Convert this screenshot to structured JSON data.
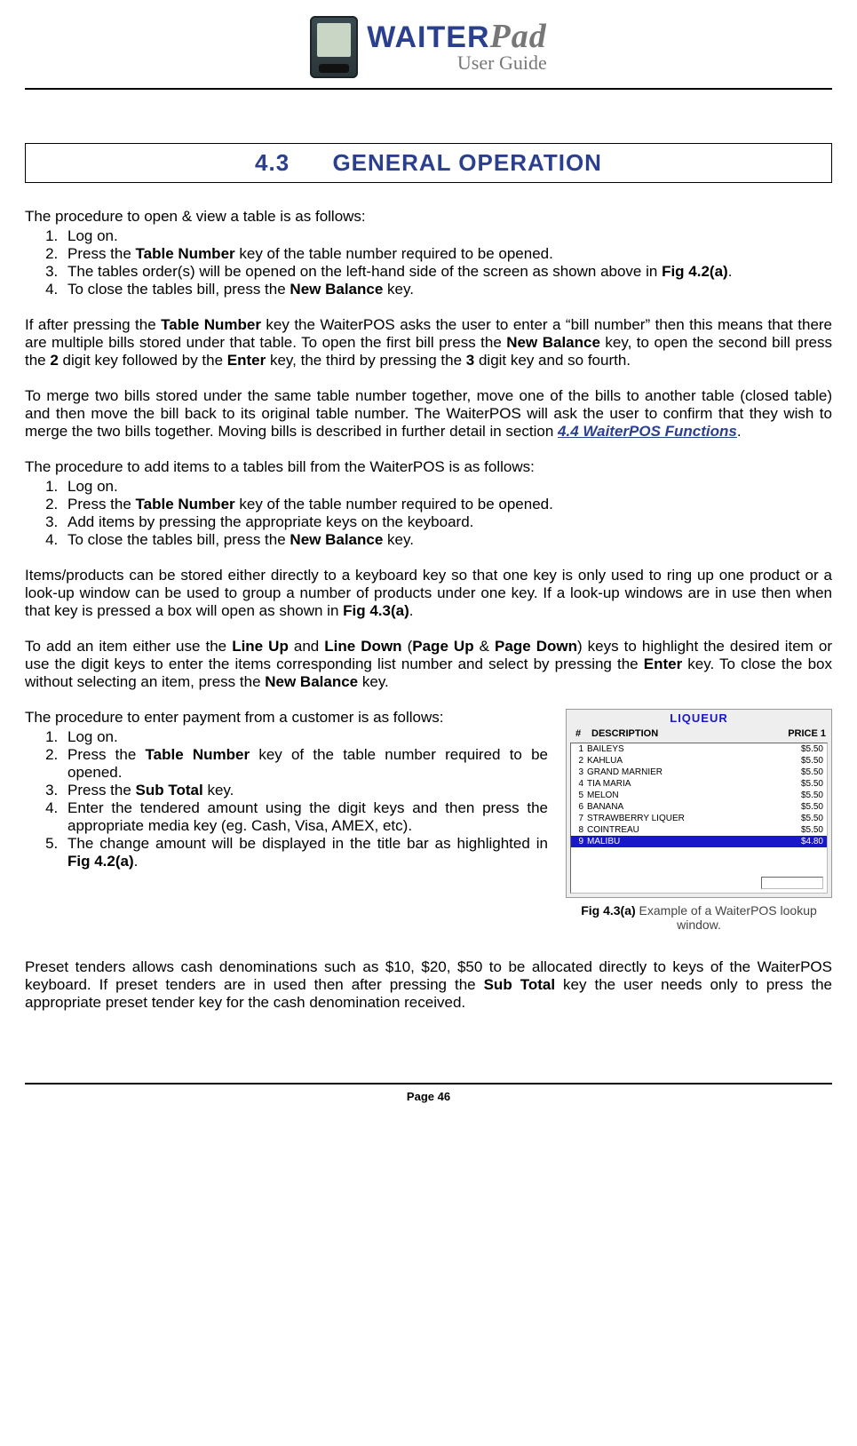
{
  "brand": {
    "name_main": "WAITER",
    "name_suffix": "Pad",
    "subtitle": "User Guide"
  },
  "section": {
    "number": "4.3",
    "title": "GENERAL OPERATION"
  },
  "proc_open_intro": "The procedure to open & view a table is as follows:",
  "proc_open": {
    "i1": "Log on.",
    "i2_a": "Press the ",
    "i2_b": "Table Number",
    "i2_c": " key of the table number required to be opened.",
    "i3_a": "The tables order(s) will be opened on the left-hand side of the screen as shown above in ",
    "i3_b": "Fig 4.2(a)",
    "i3_c": ".",
    "i4_a": "To close the tables bill, press the ",
    "i4_b": "New Balance",
    "i4_c": " key."
  },
  "bill_para": {
    "a": "If after pressing the ",
    "b": "Table Number",
    "c": " key the WaiterPOS asks the user to enter a “bill number” then this means that there are multiple bills stored under that table. To open the first bill press the ",
    "d": "New Balance",
    "e": " key, to open the second bill press the ",
    "f": "2",
    "g": " digit key followed by the ",
    "h": "Enter",
    "i": " key, the third by pressing the ",
    "j": "3",
    "k": " digit key and so fourth."
  },
  "merge_para": {
    "a": "To merge two bills stored under the same table number together, move one of the bills to another table (closed table) and then move the bill back to its original table number. The WaiterPOS will ask the user to confirm that they wish to merge the two bills together. Moving bills is described in further detail in section ",
    "link": "4.4 WaiterPOS Functions",
    "b": "."
  },
  "proc_add_intro": "The procedure to add items to a tables bill from the WaiterPOS is as follows:",
  "proc_add": {
    "i1": "Log on.",
    "i2_a": "Press the ",
    "i2_b": "Table Number",
    "i2_c": " key of the table number required to be opened.",
    "i3": "Add items by pressing the appropriate keys on the keyboard.",
    "i4_a": "To close the tables bill, press the ",
    "i4_b": "New Balance",
    "i4_c": " key."
  },
  "items_para": {
    "a": "Items/products can be stored either directly to a keyboard key so that one key is only used to ring up one product or a look-up window can be used to group a number of products under one key. If a look-up windows are in use then when that key is pressed a box will open as shown in ",
    "b": "Fig 4.3(a)",
    "c": "."
  },
  "lineup_para": {
    "a": "To add an item either use the ",
    "b": "Line Up",
    "c": " and ",
    "d": "Line Down",
    "e": " (",
    "f": "Page Up",
    "g": " & ",
    "h": "Page Down",
    "i": ") keys to highlight the desired item or use the digit keys to enter the items corresponding list number and select by pressing the ",
    "j": "Enter",
    "k": " key. To close the box without selecting an item, press the ",
    "l": "New Balance",
    "m": " key."
  },
  "proc_pay_intro": "The procedure to enter payment from a customer is as follows:",
  "proc_pay": {
    "i1": "Log on.",
    "i2_a": "Press the ",
    "i2_b": "Table Number",
    "i2_c": " key of the table number required to be opened.",
    "i3_a": "Press the ",
    "i3_b": "Sub Total",
    "i3_c": " key.",
    "i4": "Enter the tendered amount using the digit keys and then press the appropriate media key (eg. Cash, Visa, AMEX, etc).",
    "i5_a": "The change amount will be displayed in the title bar as highlighted in ",
    "i5_b": "Fig 4.2(a)",
    "i5_c": "."
  },
  "lookup": {
    "title": "LIQUEUR",
    "col_num": "#",
    "col_desc": "DESCRIPTION",
    "col_price": "PRICE 1",
    "rows": [
      {
        "n": "1",
        "d": "BAILEYS",
        "p": "$5.50"
      },
      {
        "n": "2",
        "d": "KAHLUA",
        "p": "$5.50"
      },
      {
        "n": "3",
        "d": "GRAND MARNIER",
        "p": "$5.50"
      },
      {
        "n": "4",
        "d": "TIA MARIA",
        "p": "$5.50"
      },
      {
        "n": "5",
        "d": "MELON",
        "p": "$5.50"
      },
      {
        "n": "6",
        "d": "BANANA",
        "p": "$5.50"
      },
      {
        "n": "7",
        "d": "STRAWBERRY LIQUER",
        "p": "$5.50"
      },
      {
        "n": "8",
        "d": "COINTREAU",
        "p": "$5.50"
      },
      {
        "n": "9",
        "d": "MALIBU",
        "p": "$4.80"
      }
    ],
    "caption_a": "Fig 4.3(a)",
    "caption_b": " Example of a WaiterPOS lookup window."
  },
  "preset_para": {
    "a": "Preset tenders allows cash denominations such as $10, $20, $50 to be allocated directly to keys of the WaiterPOS keyboard. If preset tenders are in used then after pressing the ",
    "b": "Sub Total",
    "c": " key the user needs only to press the appropriate preset tender key for the cash denomination received."
  },
  "footer": "Page 46"
}
